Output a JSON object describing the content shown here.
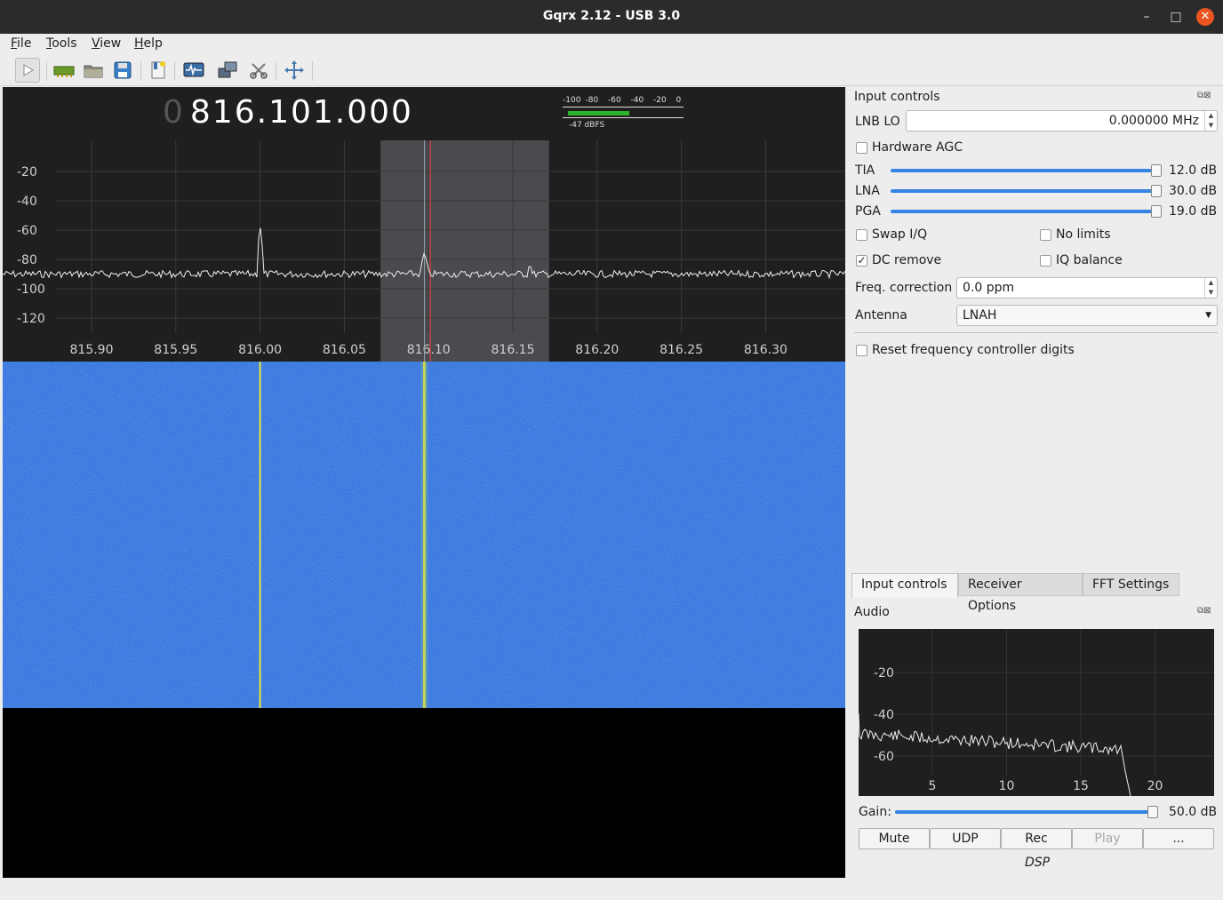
{
  "window": {
    "title": "Gqrx 2.12 - USB 3.0",
    "minimize_label": "–",
    "maximize_label": "□",
    "close_label": "✕"
  },
  "menu": {
    "file": {
      "underline": "F",
      "rest": "ile"
    },
    "tools": {
      "underline": "T",
      "rest": "ools"
    },
    "view": {
      "underline": "V",
      "rest": "iew"
    },
    "help": {
      "underline": "H",
      "rest": "elp"
    }
  },
  "toolbar": [
    "play-icon",
    "sdr-device-icon",
    "open-file-icon",
    "save-icon",
    "bookmark-icon",
    "remote-control-icon",
    "network-icon",
    "cut-icon",
    "adjust-fft-icon"
  ],
  "frequency": {
    "leading_digit": "0",
    "value": "816.101.000"
  },
  "level_meter": {
    "scale": [
      "-100",
      "-80",
      "-60",
      "-40",
      "-20",
      "0"
    ],
    "level_text": "-47 dBFS",
    "level_fraction": 0.53
  },
  "spectrum": {
    "y_ticks": [
      "-20",
      "-40",
      "-60",
      "-80",
      "-100",
      "-120"
    ],
    "x_ticks": [
      "815.90",
      "815.95",
      "816.00",
      "816.05",
      "816.10",
      "816.15",
      "816.20",
      "816.25",
      "816.30"
    ],
    "filter_low_mhz": 816.0715,
    "filter_high_mhz": 816.1715,
    "tuned_mhz": 816.101,
    "center_mhz": 816.0975,
    "peaks_mhz": [
      816.0,
      816.0975,
      816.16
    ]
  },
  "input_controls": {
    "title": "Input controls",
    "lnb_label": "LNB LO",
    "lnb_value": "0.000000 MHz",
    "hw_agc_label": "Hardware AGC",
    "hw_agc_checked": false,
    "gains": [
      {
        "label": "TIA",
        "value": "12.0 dB",
        "fraction": 1.0
      },
      {
        "label": "LNA",
        "value": "30.0 dB",
        "fraction": 1.0
      },
      {
        "label": "PGA",
        "value": "19.0 dB",
        "fraction": 1.0
      }
    ],
    "swap_iq_label": "Swap I/Q",
    "no_limits_label": "No limits",
    "dc_remove_label": "DC remove",
    "dc_remove_checked": true,
    "iq_balance_label": "IQ balance",
    "freq_corr_label": "Freq. correction",
    "freq_corr_value": "0.0 ppm",
    "antenna_label": "Antenna",
    "antenna_value": "LNAH",
    "reset_digits_label": "Reset frequency controller digits"
  },
  "tabs": [
    "Input controls",
    "Receiver Options",
    "FFT Settings"
  ],
  "audio": {
    "title": "Audio",
    "y_ticks": [
      "-20",
      "-40",
      "-60"
    ],
    "x_ticks": [
      "5",
      "10",
      "15",
      "20"
    ],
    "gain_label": "Gain:",
    "gain_value": "50.0 dB",
    "gain_fraction": 1.0,
    "buttons": [
      "Mute",
      "UDP",
      "Rec",
      "Play",
      "..."
    ],
    "dsp_label": "DSP"
  },
  "colors": {
    "waterfall": "#3c7be6",
    "signal": "#e6e640",
    "tuned_line": "#ff4040",
    "accent": "#3584e4"
  }
}
